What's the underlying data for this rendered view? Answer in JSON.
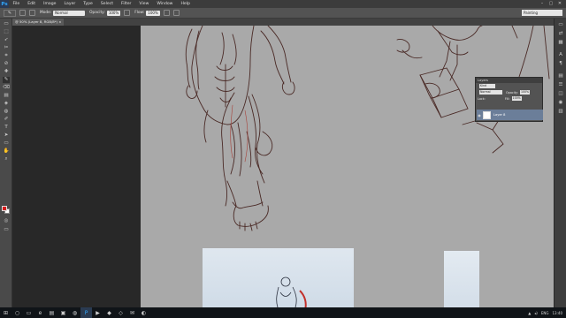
{
  "app": {
    "logo": "Ps"
  },
  "menu": [
    "File",
    "Edit",
    "Image",
    "Layer",
    "Type",
    "Select",
    "Filter",
    "View",
    "Window",
    "Help"
  ],
  "window_controls": [
    "–",
    "▢",
    "✕"
  ],
  "options": {
    "mode_label": "Mode:",
    "mode_value": "Normal",
    "opacity_label": "Opacity:",
    "opacity_value": "100%",
    "flow_label": "Flow:",
    "flow_value": "100%",
    "workspace": "Painting"
  },
  "document_tab": {
    "title": "@ 50% (Layer 8, RGB/8*) ×"
  },
  "tools": [
    "▭",
    "⬚",
    "➶",
    "✂",
    "⌗",
    "⊘",
    "✚",
    "✎",
    "⌫",
    "▤",
    "◈",
    "◍",
    "✐",
    "T",
    "➤",
    "▭",
    "✋",
    "⌕"
  ],
  "dock_icons": [
    "▭",
    "⇄",
    "▦",
    "A",
    "¶",
    "▤",
    "☰",
    "◫",
    "◉",
    "▥"
  ],
  "layers_panel": {
    "title": "Layers",
    "kind_label": "Kind",
    "blend_mode": "Normal",
    "opacity_label": "Opacity:",
    "opacity_value": "100%",
    "lock_label": "Lock:",
    "fill_label": "Fill:",
    "fill_value": "100%",
    "layer_name": "Layer 8"
  },
  "taskbar": {
    "tray_lang": "ENG",
    "tray_time": "13:40"
  }
}
